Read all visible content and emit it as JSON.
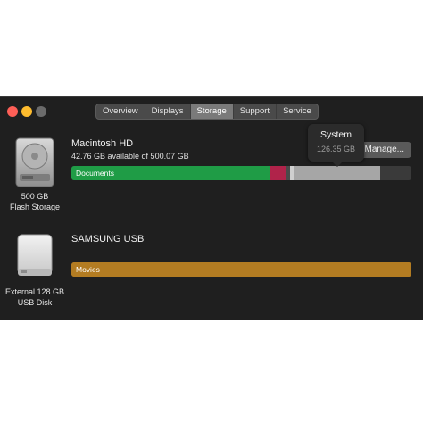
{
  "tabs": [
    {
      "label": "Overview"
    },
    {
      "label": "Displays"
    },
    {
      "label": "Storage"
    },
    {
      "label": "Support"
    },
    {
      "label": "Service"
    }
  ],
  "active_tab": "Storage",
  "colors": {
    "close": "#fe5f57",
    "minimize": "#febc2e",
    "zoom": "#6b6b6b",
    "documents": "#1f9c46",
    "other_red": "#b0234a",
    "system": "#a6a6a6",
    "movies": "#b37c22"
  },
  "drives": [
    {
      "name": "Macintosh HD",
      "available": "42.76 GB available of 500.07 GB",
      "caption_line1": "500 GB",
      "caption_line2": "Flash Storage",
      "bar_label": "Documents",
      "manage_label": "Manage...",
      "tooltip_title": "System",
      "tooltip_size": "126.35 GB"
    },
    {
      "name": "SAMSUNG USB",
      "caption_line1": "External 128 GB",
      "caption_line2": "USB Disk",
      "bar_label": "Movies"
    }
  ]
}
